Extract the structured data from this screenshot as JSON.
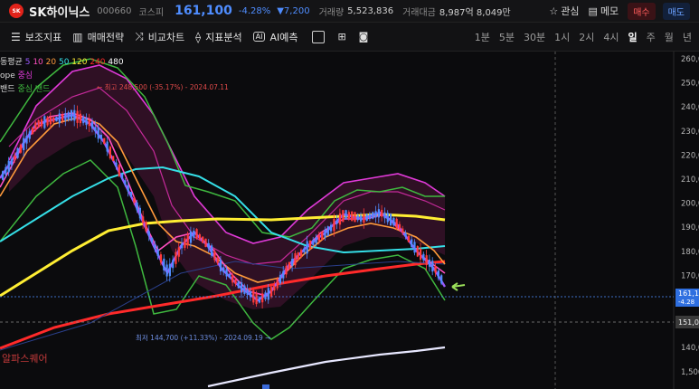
{
  "header": {
    "logo_text": "SK",
    "stock_name": "SK하이닉스",
    "stock_code": "000660",
    "market": "코스피",
    "price": "161,100",
    "change_pct": "-4.28%",
    "change_amt": "▼7,200",
    "volume_label": "거래량",
    "volume": "5,523,836",
    "turnover_label": "거래대금",
    "turnover": "8,987억 8,049만",
    "watch_label": "관심",
    "memo_label": "메모",
    "sell_label": "매수",
    "buy_label": "매도"
  },
  "toolbar": {
    "indicators_label": "보조지표",
    "strategy_label": "매매전략",
    "compare_label": "비교차트",
    "analysis_label": "지표분석",
    "ai_label": "AI예측",
    "periods": [
      "1분",
      "5분",
      "30분",
      "1시",
      "2시",
      "4시",
      "일",
      "주",
      "월",
      "년"
    ],
    "active_period": "일"
  },
  "legend": {
    "ma_label": "동평균",
    "ma_periods": [
      {
        "text": "5",
        "color": "#9b59ff"
      },
      {
        "text": "10",
        "color": "#ff4fc0"
      },
      {
        "text": "20",
        "color": "#ff9a3c"
      },
      {
        "text": "50",
        "color": "#35e0e8"
      },
      {
        "text": "120",
        "color": "#ffee33"
      },
      {
        "text": "240",
        "color": "#ff2a2a"
      },
      {
        "text": "480",
        "color": "#ffffff"
      }
    ],
    "envelope_label": "ope",
    "envelope_center": "중심",
    "band_label": "밴드",
    "band_center": "중심",
    "band_word": "밴드"
  },
  "annotations": {
    "high_text": "← 최고 248,500 (-35.17%) - 2024.07.11",
    "low_text": "최저 144,700 (+11.33%) - 2024.09.19 →"
  },
  "axis": {
    "y_ticks": [
      "260,0",
      "250,0",
      "240,0",
      "230,0",
      "220,0",
      "210,0",
      "200,0",
      "190,0",
      "180,0",
      "170,0",
      "160,0",
      "150,0",
      "140,0",
      "1,500"
    ],
    "current_price_tag": "161,1",
    "current_change_tag": "-4.28",
    "ref_price_tag": "151,0"
  },
  "watermark": "알파스퀘어",
  "colors": {
    "up": "#ff3b3b",
    "down": "#4f8dff",
    "ma5": "#9b59ff",
    "ma10": "#ff4fc0",
    "ma20": "#ff9a3c",
    "ma50": "#35e0e8",
    "ma120": "#ffee33",
    "ma240": "#ff2a2a",
    "ma480": "#ffffff",
    "bollinger": "#3fb83f",
    "envelope": "#e03ad8"
  }
}
